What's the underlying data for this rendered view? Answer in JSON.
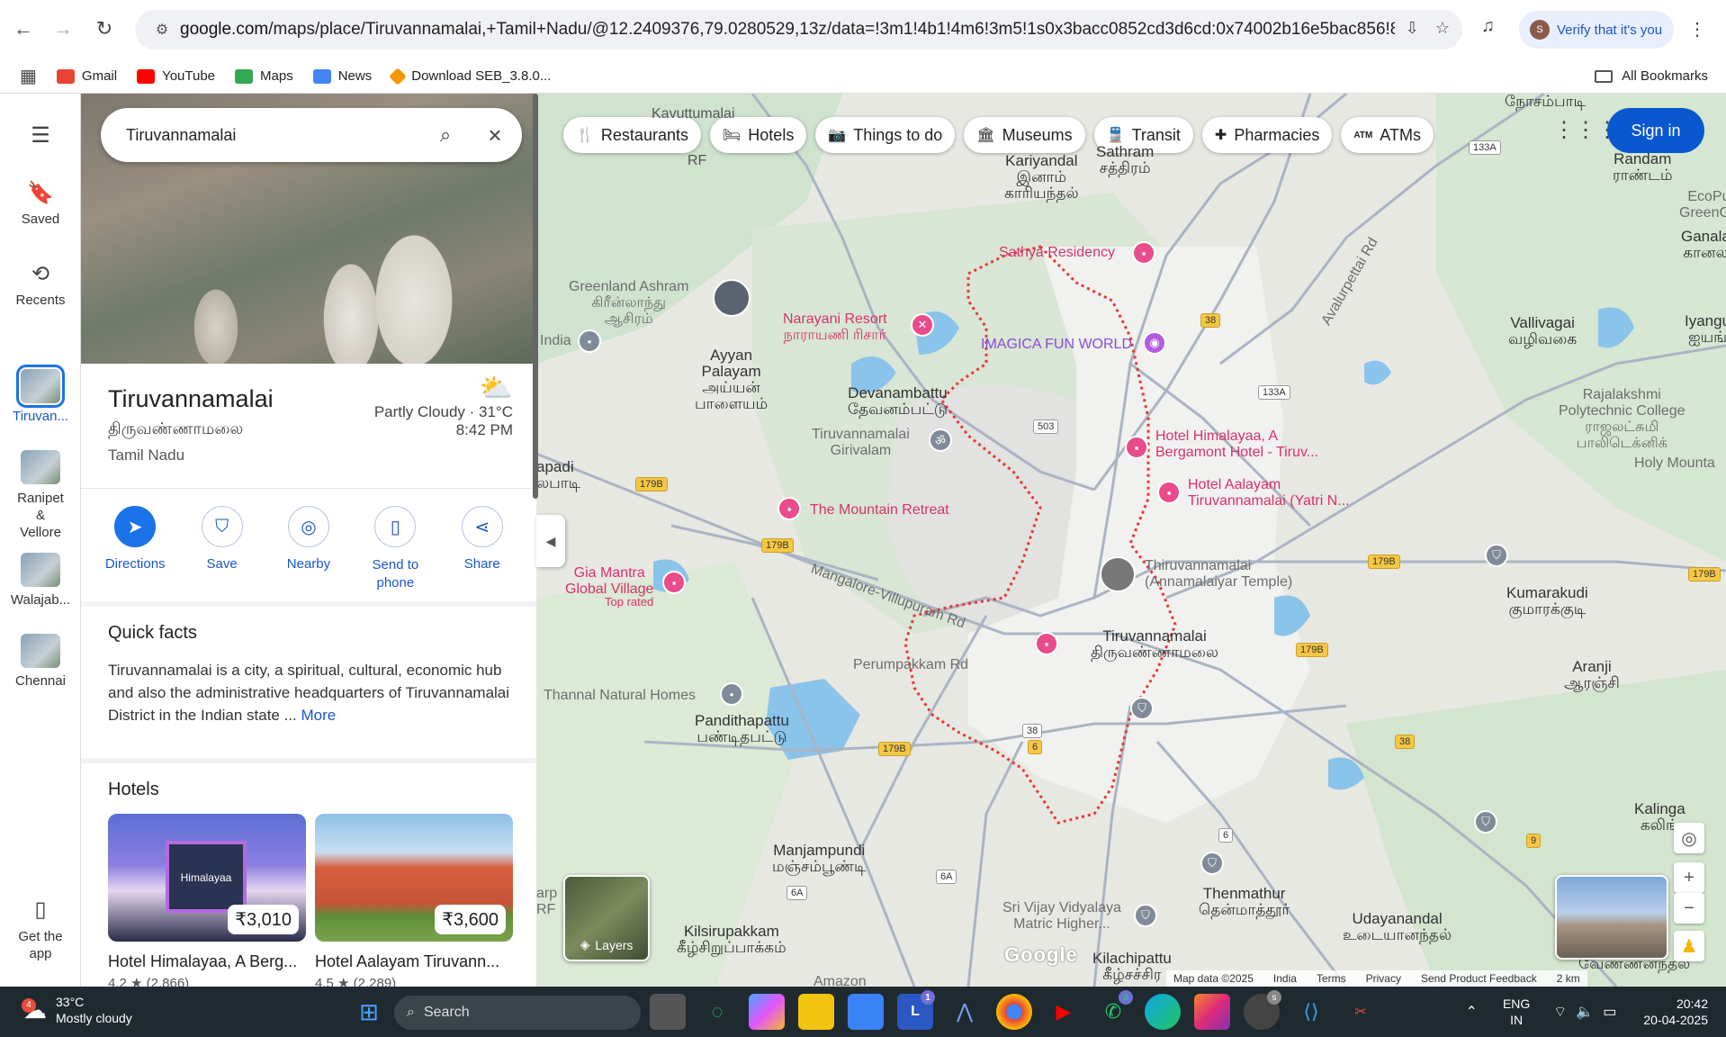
{
  "browser": {
    "url_host": "google.com",
    "url_rest": "/maps/place/Tiruvannamalai,+Tamil+Nadu/@12.2409376,79.0280529,13z/data=!3m1!4b1!4m6!3m5!1s0x3bacc0852cd3d6cd:0x74002b16e5bac856!8m2!3d12.2...",
    "verify_label": "Verify that it's you",
    "avatar_letter": "S",
    "bookmarks": [
      {
        "label": "Gmail",
        "color": "#ea4335"
      },
      {
        "label": "YouTube",
        "color": "#ff0000"
      },
      {
        "label": "Maps",
        "color": "#34a853"
      },
      {
        "label": "News",
        "color": "#4285f4"
      },
      {
        "label": "Download SEB_3.8.0...",
        "color": "#f29900"
      }
    ],
    "all_bookmarks": "All Bookmarks"
  },
  "rail": {
    "saved": "Saved",
    "recents": "Recents",
    "places": [
      {
        "label": "Tiruvan...",
        "active": true
      },
      {
        "label": "Ranipet & Vellore",
        "active": false
      },
      {
        "label": "Walajab...",
        "active": false
      },
      {
        "label": "Chennai",
        "active": false
      }
    ],
    "get_app": "Get the app"
  },
  "search": {
    "value": "Tiruvannamalai"
  },
  "place": {
    "title": "Tiruvannamalai",
    "tamil": "திருவண்ணாமலை",
    "state": "Tamil Nadu",
    "weather": "Partly Cloudy · 31°C",
    "time": "8:42 PM"
  },
  "actions": [
    {
      "label": "Directions",
      "icon": "directions-icon",
      "glyph": "➤"
    },
    {
      "label": "Save",
      "icon": "bookmark-icon",
      "glyph": "⛉"
    },
    {
      "label": "Nearby",
      "icon": "nearby-icon",
      "glyph": "◎"
    },
    {
      "label": "Send to\nphone",
      "icon": "phone-icon",
      "glyph": "▯"
    },
    {
      "label": "Share",
      "icon": "share-icon",
      "glyph": "⋖"
    }
  ],
  "quick_facts": {
    "heading": "Quick facts",
    "text": "Tiruvannamalai is a city, a spiritual, cultural, economic hub and also the administrative headquarters of Tiruvannamalai District in the Indian state ... ",
    "more": "More"
  },
  "hotels": {
    "heading": "Hotels",
    "items": [
      {
        "name": "Hotel Himalayaa, A Berg...",
        "price": "₹3,010",
        "rating": "4.2 ★ (2,866)"
      },
      {
        "name": "Hotel Aalayam Tiruvann...",
        "price": "₹3,600",
        "rating": "4.5 ★ (2,289)"
      }
    ]
  },
  "map": {
    "chips": [
      {
        "label": "Restaurants",
        "glyph": "🍴"
      },
      {
        "label": "Hotels",
        "glyph": "🛏"
      },
      {
        "label": "Things to do",
        "glyph": "📷"
      },
      {
        "label": "Museums",
        "glyph": "🏛"
      },
      {
        "label": "Transit",
        "glyph": "🚆"
      },
      {
        "label": "Pharmacies",
        "glyph": "✚"
      },
      {
        "label": "ATMs",
        "glyph": "ATM"
      }
    ],
    "sign_in": "Sign in",
    "layers": "Layers",
    "labels": {
      "kayuttumalai": "Kavuttumalai",
      "rf": "RF",
      "kariyandal": "Kariyandal\nஇனாம்\nகாரியந்தல்",
      "sathram": "Sathram\nசத்திரம்",
      "nochampadi": "நோசம்பாடி",
      "randam": "Randam\nராண்டம்",
      "ecopu": "EcoPu\nGreenGo",
      "ganala": "Ganala\nகானல",
      "sathya": "Sathya Residency",
      "greenland": "Greenland Ashram\nகிரீன்லாந்து\nஆசிரம்",
      "narayani": "Narayani Resort\nநாராயணி ரிசார்",
      "imagica": "IMAGICA FUN WORLD",
      "india": "India",
      "ayyan": "Ayyan\nPalayam\nஅய்யன்\nபாளையம்",
      "devanambattu": "Devanambattu\nதேவனம்பட்டு",
      "girivalam": "Tiruvannamalai\nGirivalam",
      "vallivagai": "Vallivagai\nவழிவகை",
      "iyangu": "Iyangu\nஐயங்",
      "rajalakshmi": "Rajalakshmi\nPolytechnic College\nராஜலட்சுமி\nபாலிடெக்னிக்",
      "holy_mount": "Holy Mounta",
      "himalayaa": "Hotel Himalayaa, A\nBergamont Hotel - Tiruv...",
      "aalayam": "Hotel Aalayam\nTiruvannamalai (Yatri N...",
      "apadi": "apadi\nலபாடி",
      "mountain": "The Mountain Retreat",
      "temple": "Thiruvannamalai\n(Annamalaiyar Temple)",
      "kumarakudi": "Kumarakudi\nகுமாரக்குடி",
      "gia": "Gia Mantra\nGlobal Village",
      "toprated": "Top rated",
      "villupuram": "Mangalore-Villupuram Rd",
      "city": "Tiruvannamalai\nதிருவண்ணாமலை",
      "perumpakkam": "Perumpakkam Rd",
      "aranji": "Aranji\nஆரஞ்சி",
      "thannal": "Thannal Natural Homes",
      "pandithapattu": "Pandithapattu\nபண்டிதபட்டு",
      "manjampundi": "Manjampundi\nமஞ்சம்பூண்டி",
      "kalinga": "Kalinga\nகலிங்",
      "thenmathur": "Thenmathur\nதென்மாத்தூர்",
      "srivijay": "Sri Vijay Vidyalaya\nMatric Higher...",
      "udayanandal": "Udayanandal\nஉடையானந்தல்",
      "kilsirupakkam": "Kilsirupakkam\nகீழ்சிறுப்பாக்கம்",
      "kilachipattu": "Kilachipattu\nகீழ்சச்சிர",
      "amazon": "Amazon",
      "vennanandal": "வேண்ணனந்தல்",
      "avalurpettai": "Avalurpettai Rd",
      "arp": "arp\nRF"
    },
    "shields": [
      "133A",
      "38",
      "133A",
      "503",
      "179B",
      "179B",
      "179B",
      "179B",
      "179B",
      "179B",
      "6",
      "38",
      "38",
      "9",
      "6",
      "6A",
      "6A"
    ],
    "attribution": [
      "Map data ©2025",
      "India",
      "Terms",
      "Privacy",
      "Send Product Feedback",
      "2 km"
    ],
    "google": "Google"
  },
  "taskbar": {
    "temp": "33°C",
    "condition": "Mostly cloudy",
    "weather_badge": "4",
    "search": "Search",
    "lang": "ENG\nIN",
    "time": "20:42",
    "date": "20-04-2025"
  },
  "colors": {
    "accent": "#1a73e8",
    "signin": "#0b57d0",
    "pin": "#e94b8b",
    "boundary": "#e53935"
  }
}
